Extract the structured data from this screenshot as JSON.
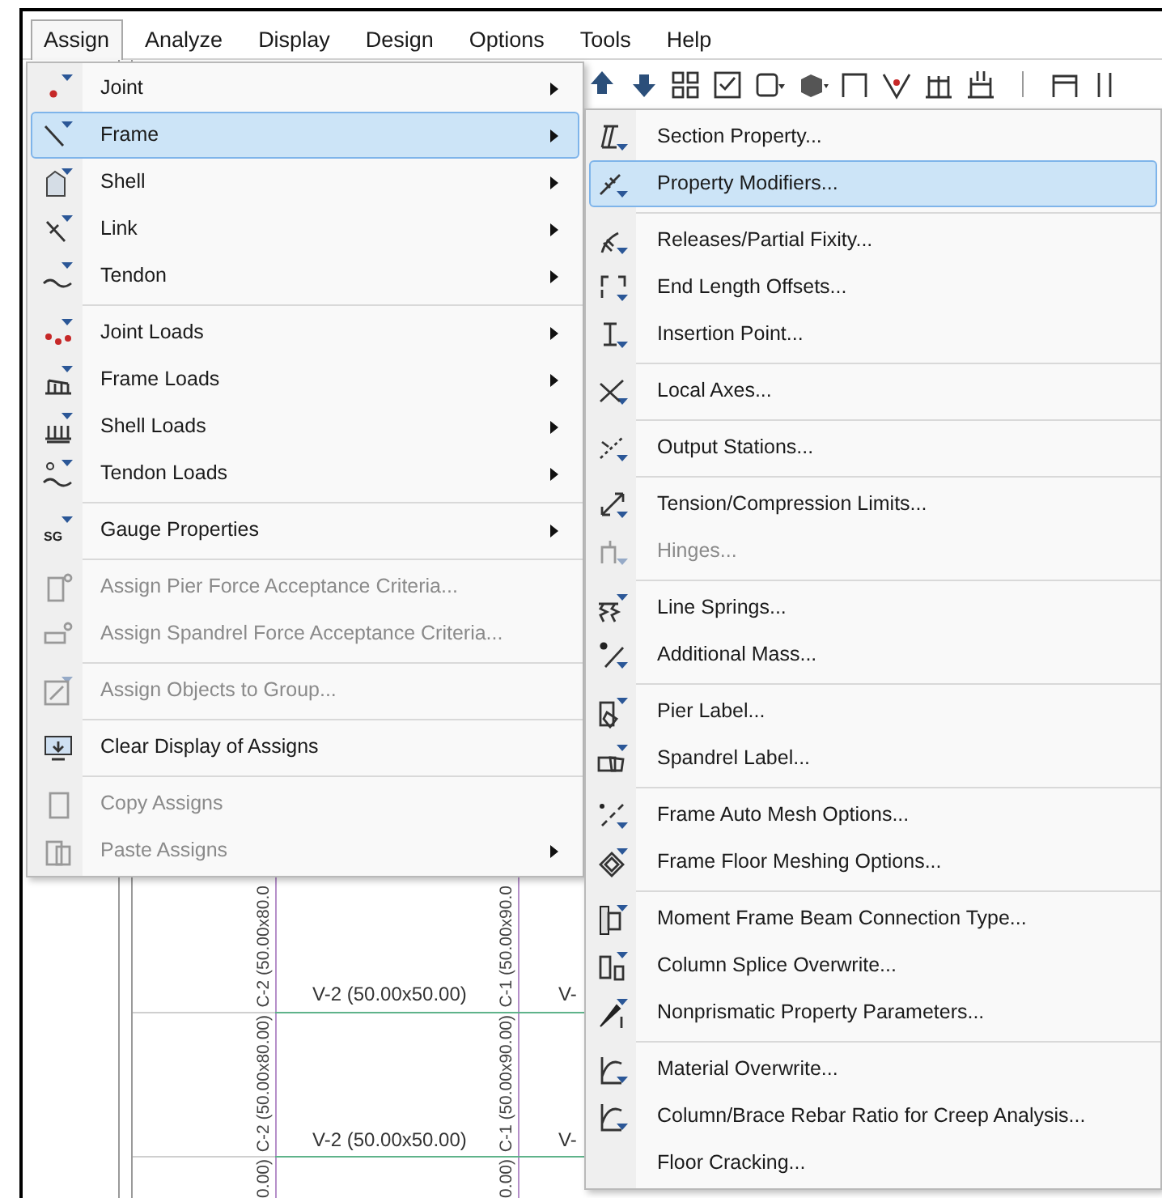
{
  "menu_bar": [
    {
      "label": "Assign",
      "selected": true
    },
    {
      "label": "Analyze",
      "selected": false
    },
    {
      "label": "Display",
      "selected": false
    },
    {
      "label": "Design",
      "selected": false
    },
    {
      "label": "Options",
      "selected": false
    },
    {
      "label": "Tools",
      "selected": false
    },
    {
      "label": "Help",
      "selected": false
    }
  ],
  "assign_menu": {
    "groups": [
      [
        {
          "label": "Joint",
          "has_submenu": true,
          "disabled": false,
          "selected": false
        },
        {
          "label": "Frame",
          "has_submenu": true,
          "disabled": false,
          "selected": true
        },
        {
          "label": "Shell",
          "has_submenu": true,
          "disabled": false,
          "selected": false
        },
        {
          "label": "Link",
          "has_submenu": true,
          "disabled": false,
          "selected": false
        },
        {
          "label": "Tendon",
          "has_submenu": true,
          "disabled": false,
          "selected": false
        }
      ],
      [
        {
          "label": "Joint Loads",
          "has_submenu": true,
          "disabled": false,
          "selected": false
        },
        {
          "label": "Frame Loads",
          "has_submenu": true,
          "disabled": false,
          "selected": false
        },
        {
          "label": "Shell Loads",
          "has_submenu": true,
          "disabled": false,
          "selected": false
        },
        {
          "label": "Tendon Loads",
          "has_submenu": true,
          "disabled": false,
          "selected": false
        }
      ],
      [
        {
          "label": "Gauge Properties",
          "icon_text": "SG",
          "has_submenu": true,
          "disabled": false,
          "selected": false
        }
      ],
      [
        {
          "label": "Assign Pier Force Acceptance Criteria...",
          "has_submenu": false,
          "disabled": true,
          "selected": false
        },
        {
          "label": "Assign Spandrel Force Acceptance Criteria...",
          "has_submenu": false,
          "disabled": true,
          "selected": false
        }
      ],
      [
        {
          "label": "Assign Objects to Group...",
          "has_submenu": false,
          "disabled": true,
          "selected": false
        }
      ],
      [
        {
          "label": "Clear Display of Assigns",
          "has_submenu": false,
          "disabled": false,
          "selected": false
        }
      ],
      [
        {
          "label": "Copy Assigns",
          "has_submenu": false,
          "disabled": true,
          "selected": false
        },
        {
          "label": "Paste Assigns",
          "has_submenu": true,
          "disabled": true,
          "selected": false
        }
      ]
    ]
  },
  "frame_submenu": {
    "groups": [
      [
        {
          "label": "Section Property...",
          "disabled": false,
          "selected": false
        },
        {
          "label": "Property Modifiers...",
          "disabled": false,
          "selected": true
        }
      ],
      [
        {
          "label": "Releases/Partial Fixity...",
          "disabled": false,
          "selected": false
        },
        {
          "label": "End Length Offsets...",
          "disabled": false,
          "selected": false
        },
        {
          "label": "Insertion Point...",
          "disabled": false,
          "selected": false
        }
      ],
      [
        {
          "label": "Local Axes...",
          "disabled": false,
          "selected": false
        }
      ],
      [
        {
          "label": "Output Stations...",
          "disabled": false,
          "selected": false
        }
      ],
      [
        {
          "label": "Tension/Compression Limits...",
          "disabled": false,
          "selected": false
        },
        {
          "label": "Hinges...",
          "disabled": true,
          "selected": false
        }
      ],
      [
        {
          "label": "Line Springs...",
          "disabled": false,
          "selected": false
        },
        {
          "label": "Additional Mass...",
          "disabled": false,
          "selected": false
        }
      ],
      [
        {
          "label": "Pier Label...",
          "disabled": false,
          "selected": false
        },
        {
          "label": "Spandrel Label...",
          "disabled": false,
          "selected": false
        }
      ],
      [
        {
          "label": "Frame Auto Mesh Options...",
          "disabled": false,
          "selected": false
        },
        {
          "label": "Frame Floor Meshing Options...",
          "disabled": false,
          "selected": false
        }
      ],
      [
        {
          "label": "Moment Frame Beam Connection Type...",
          "disabled": false,
          "selected": false
        },
        {
          "label": "Column Splice Overwrite...",
          "disabled": false,
          "selected": false
        },
        {
          "label": "Nonprismatic Property Parameters...",
          "disabled": false,
          "selected": false
        }
      ],
      [
        {
          "label": "Material Overwrite...",
          "disabled": false,
          "selected": false
        },
        {
          "label": "Column/Brace Rebar Ratio for Creep Analysis...",
          "disabled": false,
          "selected": false
        },
        {
          "label": "Floor Cracking...",
          "disabled": false,
          "selected": false
        }
      ]
    ]
  },
  "canvas": {
    "beam_labels": [
      "V-2 (50.00x50.00)",
      "V-",
      "V-2 (50.00x50.00)",
      "V-"
    ],
    "column_labels": [
      "C-2 (50.00x80.0",
      "C-1 (50.00x90.0",
      "C-2 (50.00x80.00)",
      "C-1 (50.00x90.00)",
      "0.00)",
      "0.00)"
    ]
  }
}
